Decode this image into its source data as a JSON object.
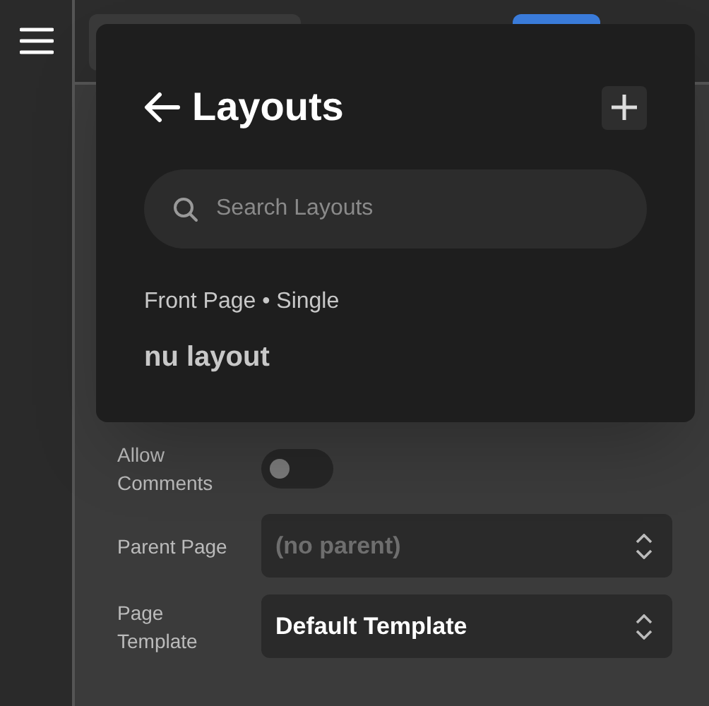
{
  "popover": {
    "title": "Layouts",
    "search": {
      "placeholder": "Search Layouts"
    },
    "layouts": [
      {
        "meta": "Front Page • Single",
        "name": "nu layout"
      }
    ]
  },
  "settings": [
    {
      "kind": "toggle",
      "label": "Allow Comments",
      "on": false
    },
    {
      "kind": "select",
      "label": "Parent Page",
      "placeholder": "(no parent)"
    },
    {
      "kind": "select",
      "label": "Page Template",
      "value": "Default Template"
    }
  ]
}
